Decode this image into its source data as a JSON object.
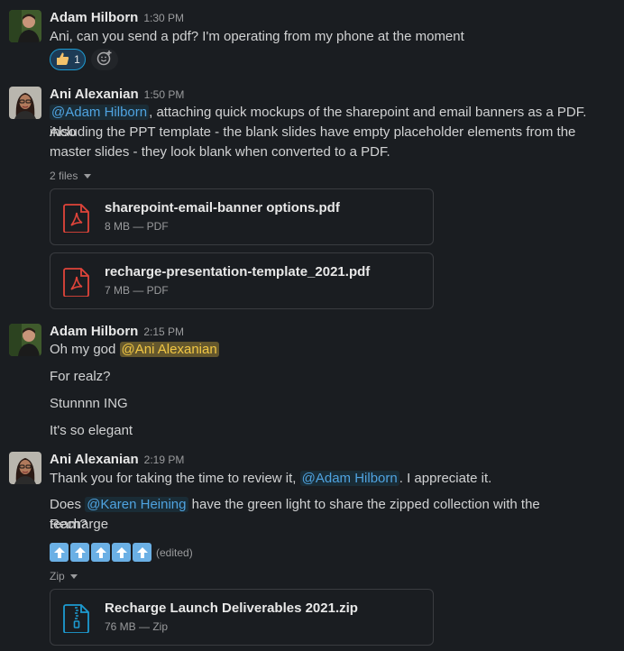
{
  "messages": [
    {
      "author": "Adam Hilborn",
      "time": "1:30 PM",
      "text": "Ani, can you send a pdf? I'm operating from my phone at the moment",
      "reaction": {
        "emoji": "thumbs-up",
        "count": "1"
      }
    },
    {
      "author": "Ani Alexanian",
      "time": "1:50 PM",
      "mention": "@Adam Hilborn",
      "text_line1_rest": ", attaching quick mockups of the sharepoint and email banners as a PDF. Also",
      "text_line2": "including the PPT template - the blank slides have empty placeholder elements from the",
      "text_line3": "master slides - they look blank when converted to a PDF.",
      "files_label": "2 files",
      "files": [
        {
          "name": "sharepoint-email-banner options.pdf",
          "meta": "8 MB — PDF",
          "icon": "pdf-icon"
        },
        {
          "name": "recharge-presentation-template_2021.pdf",
          "meta": "7 MB — PDF",
          "icon": "pdf-icon"
        }
      ]
    },
    {
      "author": "Adam Hilborn",
      "time": "2:15 PM",
      "line1_text": "Oh my god",
      "line1_mention": "@Ani Alexanian",
      "line2": "For realz?",
      "line3": "Stunnnn ING",
      "line4": "It's so elegant"
    },
    {
      "author": "Ani Alexanian",
      "time": "2:19 PM",
      "p1_text": "Thank you for taking the time to review it,",
      "p1_mention": "@Adam Hilborn",
      "p1_end": ". I appreciate it.",
      "p2_start": "Does",
      "p2_mention": "@Karen Heining",
      "p2_rest": "have the green light to share the zipped collection with the Recharge",
      "p2_line2": "team?",
      "emojis": [
        "arrow-up",
        "arrow-up",
        "arrow-up",
        "arrow-up",
        "arrow-up"
      ],
      "edited": "(edited)",
      "files_label": "Zip",
      "files": [
        {
          "name": "Recharge Launch Deliverables 2021.zip",
          "meta": "76 MB — Zip",
          "icon": "zip-icon"
        }
      ]
    }
  ],
  "colors": {
    "background": "#1a1d21",
    "mention": "#4fa3e0",
    "mention_self": "#f2c744",
    "pdf": "#e0443a",
    "zip": "#1d9bd1"
  }
}
